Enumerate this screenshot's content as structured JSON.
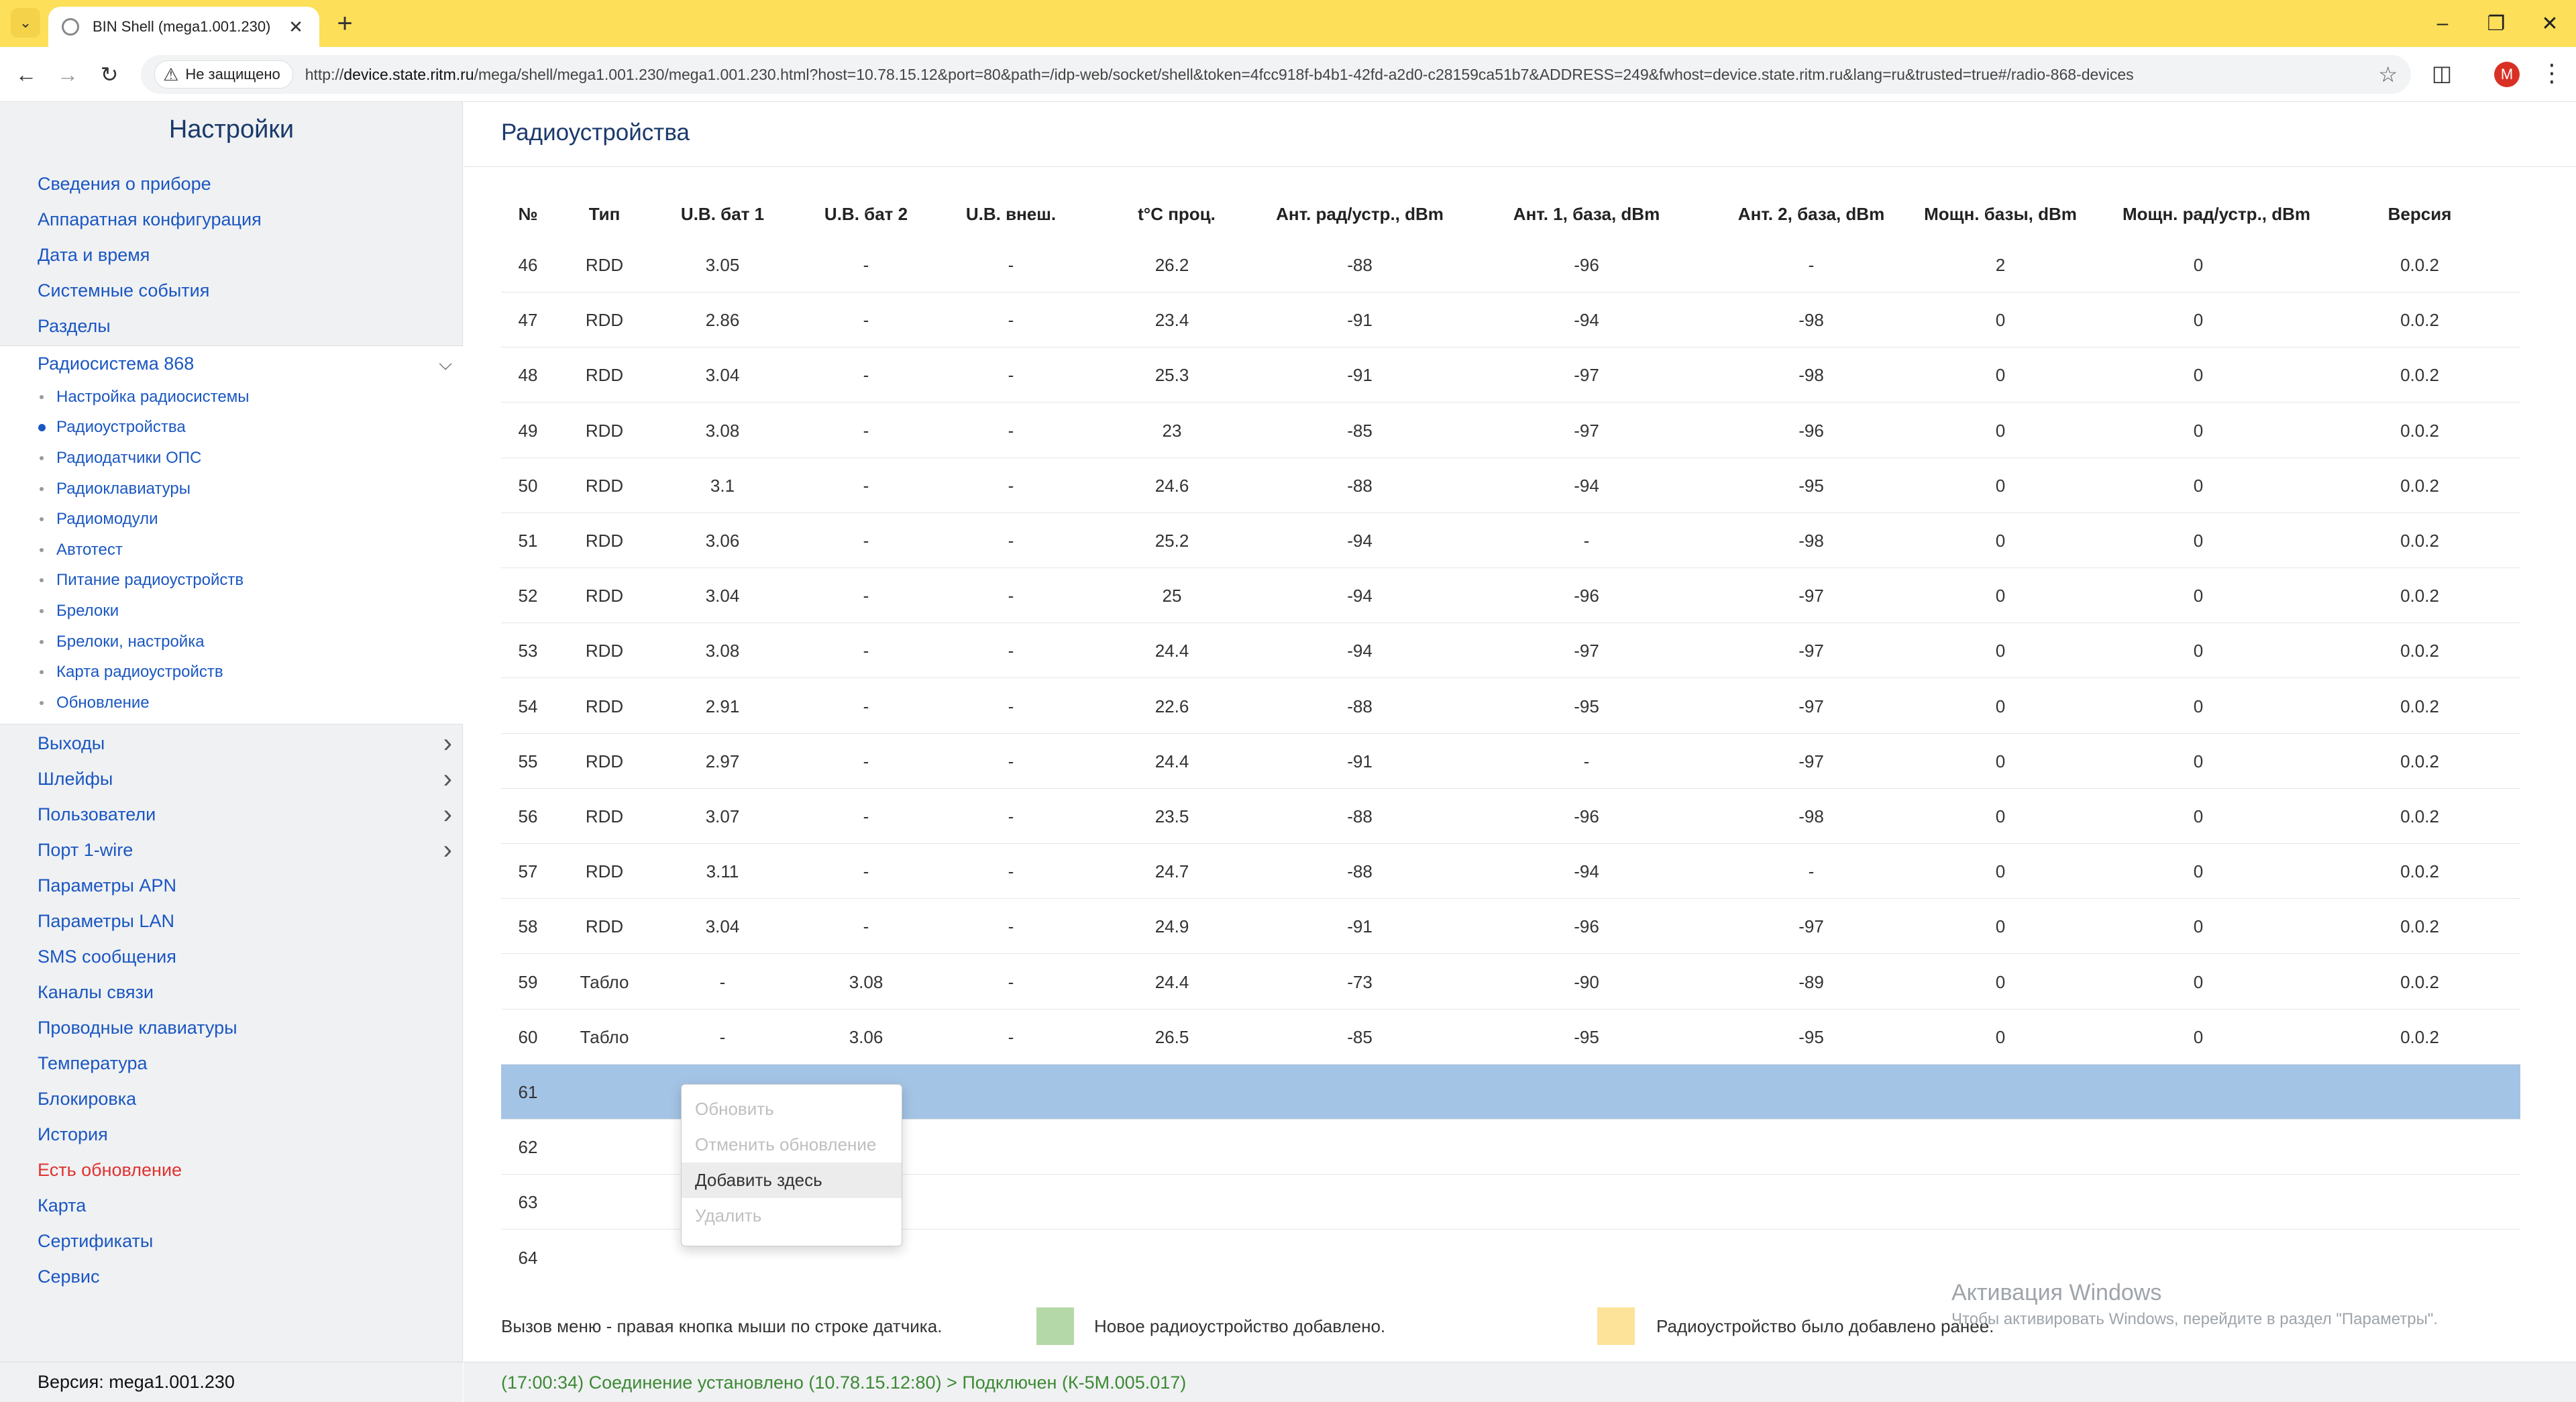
{
  "browser": {
    "tab_title": "BIN Shell (mega1.001.230)",
    "security_label": "Не защищено",
    "url_prefix": "http://",
    "url_host": "device.state.ritm.ru",
    "url_rest": "/mega/shell/mega1.001.230/mega1.001.230.html?host=10.78.15.12&port=80&path=/idp-web/socket/shell&token=4fcc918f-b4b1-42fd-a2d0-c28159ca51b7&ADDRESS=249&fwhost=device.state.ritm.ru&lang=ru&trusted=true#/radio-868-devices",
    "profile_initial": "M"
  },
  "sidebar": {
    "title": "Настройки",
    "items_top": [
      {
        "label": "Сведения о приборе"
      },
      {
        "label": "Аппаратная конфигурация"
      },
      {
        "label": "Дата и время"
      },
      {
        "label": "Системные события"
      },
      {
        "label": "Разделы"
      }
    ],
    "group": {
      "label": "Радиосистема 868",
      "children": [
        {
          "label": "Настройка радиосистемы",
          "active": false
        },
        {
          "label": "Радиоустройства",
          "active": true
        },
        {
          "label": "Радиодатчики ОПС",
          "active": false
        },
        {
          "label": "Радиоклавиатуры",
          "active": false
        },
        {
          "label": "Радиомодули",
          "active": false
        },
        {
          "label": "Автотест",
          "active": false
        },
        {
          "label": "Питание радиоустройств",
          "active": false
        },
        {
          "label": "Брелоки",
          "active": false
        },
        {
          "label": "Брелоки, настройка",
          "active": false
        },
        {
          "label": "Карта радиоустройств",
          "active": false
        },
        {
          "label": "Обновление",
          "active": false
        }
      ]
    },
    "items_bottom": [
      {
        "label": "Выходы",
        "has_children": true
      },
      {
        "label": "Шлейфы",
        "has_children": true
      },
      {
        "label": "Пользователи",
        "has_children": true
      },
      {
        "label": "Порт 1-wire",
        "has_children": true
      },
      {
        "label": "Параметры APN"
      },
      {
        "label": "Параметры LAN"
      },
      {
        "label": "SMS сообщения"
      },
      {
        "label": "Каналы связи"
      },
      {
        "label": "Проводные клавиатуры"
      },
      {
        "label": "Температура"
      },
      {
        "label": "Блокировка"
      },
      {
        "label": "История"
      },
      {
        "label": "Есть обновление",
        "alert": true
      },
      {
        "label": "Карта"
      },
      {
        "label": "Сертификаты"
      },
      {
        "label": "Сервис"
      }
    ],
    "version": "Версия: mega1.001.230"
  },
  "main": {
    "title": "Радиоустройства",
    "columns": [
      "№",
      "Тип",
      "U.В. бат 1",
      "U.В. бат 2",
      "U.В. внеш.",
      "t°C проц.",
      "Ант. рад/устр., dBm",
      "Ант. 1, база, dBm",
      "Ант. 2, база, dBm",
      "Мощн. базы, dBm",
      "Мощн. рад/устр., dBm",
      "Версия"
    ],
    "rows": [
      [
        "46",
        "RDD",
        "3.05",
        "-",
        "-",
        "26.2",
        "-88",
        "-96",
        "-",
        "2",
        "0",
        "0.0.2"
      ],
      [
        "47",
        "RDD",
        "2.86",
        "-",
        "-",
        "23.4",
        "-91",
        "-94",
        "-98",
        "0",
        "0",
        "0.0.2"
      ],
      [
        "48",
        "RDD",
        "3.04",
        "-",
        "-",
        "25.3",
        "-91",
        "-97",
        "-98",
        "0",
        "0",
        "0.0.2"
      ],
      [
        "49",
        "RDD",
        "3.08",
        "-",
        "-",
        "23",
        "-85",
        "-97",
        "-96",
        "0",
        "0",
        "0.0.2"
      ],
      [
        "50",
        "RDD",
        "3.1",
        "-",
        "-",
        "24.6",
        "-88",
        "-94",
        "-95",
        "0",
        "0",
        "0.0.2"
      ],
      [
        "51",
        "RDD",
        "3.06",
        "-",
        "-",
        "25.2",
        "-94",
        "-",
        "-98",
        "0",
        "0",
        "0.0.2"
      ],
      [
        "52",
        "RDD",
        "3.04",
        "-",
        "-",
        "25",
        "-94",
        "-96",
        "-97",
        "0",
        "0",
        "0.0.2"
      ],
      [
        "53",
        "RDD",
        "3.08",
        "-",
        "-",
        "24.4",
        "-94",
        "-97",
        "-97",
        "0",
        "0",
        "0.0.2"
      ],
      [
        "54",
        "RDD",
        "2.91",
        "-",
        "-",
        "22.6",
        "-88",
        "-95",
        "-97",
        "0",
        "0",
        "0.0.2"
      ],
      [
        "55",
        "RDD",
        "2.97",
        "-",
        "-",
        "24.4",
        "-91",
        "-",
        "-97",
        "0",
        "0",
        "0.0.2"
      ],
      [
        "56",
        "RDD",
        "3.07",
        "-",
        "-",
        "23.5",
        "-88",
        "-96",
        "-98",
        "0",
        "0",
        "0.0.2"
      ],
      [
        "57",
        "RDD",
        "3.11",
        "-",
        "-",
        "24.7",
        "-88",
        "-94",
        "-",
        "0",
        "0",
        "0.0.2"
      ],
      [
        "58",
        "RDD",
        "3.04",
        "-",
        "-",
        "24.9",
        "-91",
        "-96",
        "-97",
        "0",
        "0",
        "0.0.2"
      ],
      [
        "59",
        "Табло",
        "-",
        "3.08",
        "-",
        "24.4",
        "-73",
        "-90",
        "-89",
        "0",
        "0",
        "0.0.2"
      ],
      [
        "60",
        "Табло",
        "-",
        "3.06",
        "-",
        "26.5",
        "-85",
        "-95",
        "-95",
        "0",
        "0",
        "0.0.2"
      ],
      [
        "61",
        "",
        "",
        "",
        "",
        "",
        "",
        "",
        "",
        "",
        "",
        ""
      ],
      [
        "62",
        "",
        "",
        "",
        "",
        "",
        "",
        "",
        "",
        "",
        "",
        ""
      ],
      [
        "63",
        "",
        "",
        "",
        "",
        "",
        "",
        "",
        "",
        "",
        "",
        ""
      ],
      [
        "64",
        "",
        "",
        "",
        "",
        "",
        "",
        "",
        "",
        "",
        "",
        ""
      ]
    ],
    "selected_row": "61",
    "context_menu": [
      {
        "label": "Обновить",
        "enabled": false
      },
      {
        "label": "Отменить обновление",
        "enabled": false
      },
      {
        "label": "Добавить здесь",
        "enabled": true
      },
      {
        "label": "Удалить",
        "enabled": false
      }
    ],
    "legend": {
      "hint": "Вызов меню - правая кнопка мыши по строке датчика.",
      "new_label": "Новое радиоустройство добавлено.",
      "new_color": "#b5d8a8",
      "old_label": "Радиоустройство было добавлено ранее.",
      "old_color": "#fde29a"
    }
  },
  "watermark": {
    "title": "Активация Windows",
    "subtitle": "Чтобы активировать Windows, перейдите в раздел \"Параметры\"."
  },
  "status": {
    "text": "(17:00:34) Соединение установлено (10.78.15.12:80) > Подключен (К-5М.005.017)"
  },
  "colors": {
    "accent_link": "#1a57c2",
    "title": "#1b3a6b",
    "selected_row": "#a4c4e6",
    "status_text": "#3c8a34",
    "alert": "#e0322f"
  }
}
